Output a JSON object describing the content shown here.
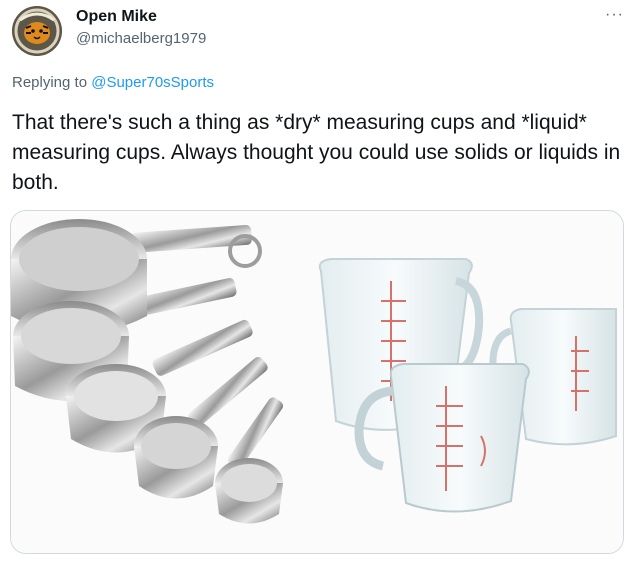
{
  "author": {
    "display_name": "Open Mike",
    "handle": "@michaelberg1979",
    "avatar_icon": "bengal-tiger-avatar"
  },
  "menu": {
    "more_label": "···"
  },
  "reply": {
    "prefix": "Replying to ",
    "mention": "@Super70sSports"
  },
  "tweet": {
    "text": "That there's such a thing as *dry* measuring cups and *liquid* measuring cups. Always thought you could use solids or liquids in both."
  },
  "media": {
    "description_icons": [
      "dry-measuring-cups",
      "liquid-measuring-cups"
    ]
  },
  "colors": {
    "link": "#1d9bf0",
    "secondary_text": "#536471",
    "border": "#cfd9de"
  }
}
